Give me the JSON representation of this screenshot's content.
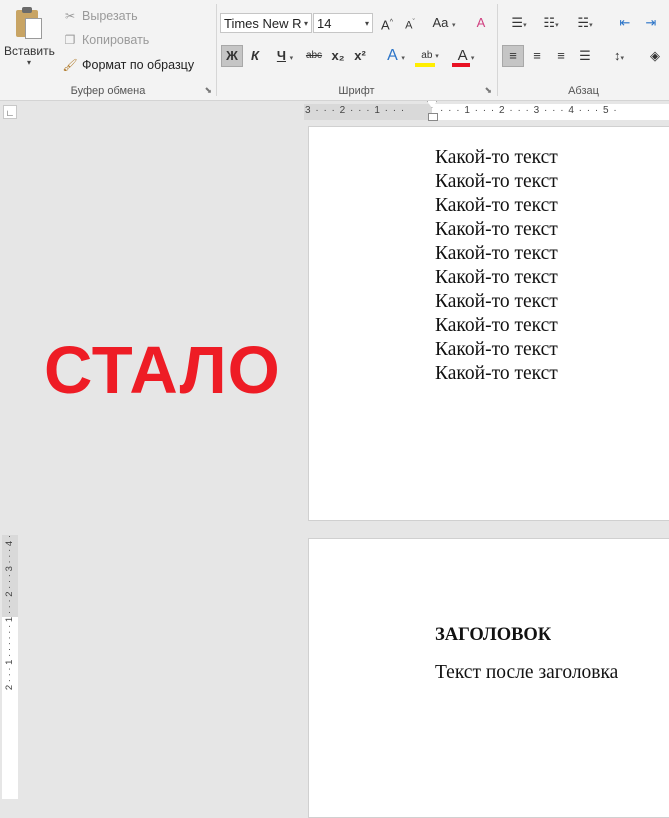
{
  "ribbon": {
    "clipboard": {
      "paste_label": "Вставить",
      "cut_label": "Вырезать",
      "copy_label": "Копировать",
      "format_painter_label": "Формат по образцу",
      "group_label": "Буфер обмена"
    },
    "font": {
      "font_name": "Times New R",
      "font_size": "14",
      "grow_label": "A",
      "shrink_label": "A",
      "case_label": "Aa",
      "bold_label": "Ж",
      "italic_label": "К",
      "underline_label": "Ч",
      "strike_label": "abc",
      "subscript_label": "x₂",
      "superscript_label": "x²",
      "effects_label": "A",
      "highlight_label": "ab",
      "color_label": "A",
      "group_label": "Шрифт",
      "highlight_color": "#ffee00",
      "font_color": "#e81123"
    },
    "paragraph": {
      "group_label": "Абзац"
    }
  },
  "ruler": {
    "corner_label": "∟",
    "left_marks": "3 · · · 2 · · · 1 · · ·",
    "right_marks": "· · · 1 · · · 2 · · · 3 · · · 4 · · · 5 ·",
    "vertical_marks": "2 · · · 1 · · · · · · 1 · · · 2 · · · 3 · · · 4 ·"
  },
  "page1": {
    "lines": [
      "Какой-то текст",
      "Какой-то текст",
      "Какой-то текст",
      "Какой-то текст",
      "Какой-то текст",
      "Какой-то текст",
      "Какой-то текст",
      "Какой-то текст",
      "Какой-то текст",
      "Какой-то текст"
    ]
  },
  "page2": {
    "heading": "ЗАГОЛОВОК",
    "body": "Текст после заголовка"
  },
  "overlay": {
    "label": "СТАЛО",
    "color": "#ee1c25"
  }
}
